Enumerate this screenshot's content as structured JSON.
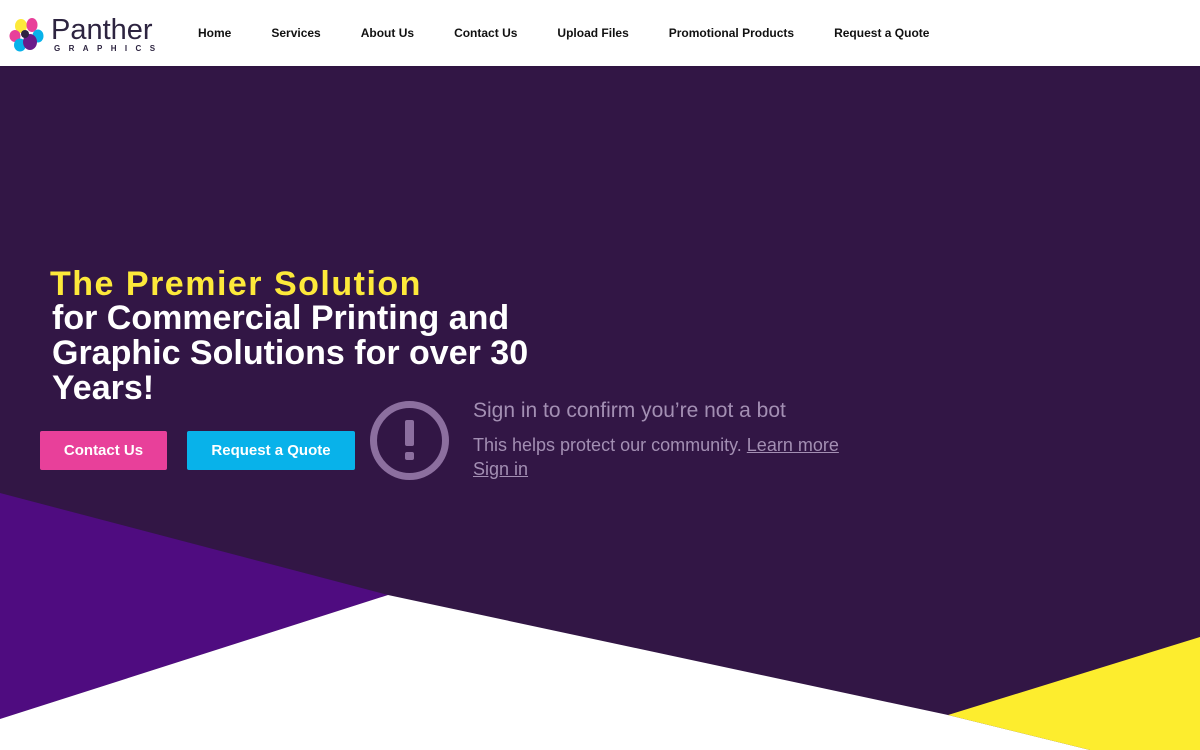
{
  "brand": {
    "name": "Panther",
    "tagline": "GRAPHICS",
    "colors": {
      "cyan": "#08b2ea",
      "magenta": "#e8409a",
      "yellow": "#fde93a",
      "purple": "#321645",
      "deep_purple": "#4f0c80"
    }
  },
  "nav": {
    "items": [
      {
        "label": "Home"
      },
      {
        "label": "Services"
      },
      {
        "label": "About Us"
      },
      {
        "label": "Contact Us"
      },
      {
        "label": "Upload Files"
      },
      {
        "label": "Promotional Products"
      },
      {
        "label": "Request a Quote"
      }
    ]
  },
  "hero": {
    "headline_highlight": "The Premier Solution",
    "headline_rest": "for Commercial Printing and Graphic Solutions for over 30 Years!",
    "buttons": {
      "contact": "Contact Us",
      "quote": "Request a Quote"
    }
  },
  "bot_notice": {
    "icon": "exclamation-circle-icon",
    "title": "Sign in to confirm you’re not a bot",
    "body": "This helps protect our community.",
    "learn_more": "Learn more",
    "sign_in": "Sign in"
  }
}
